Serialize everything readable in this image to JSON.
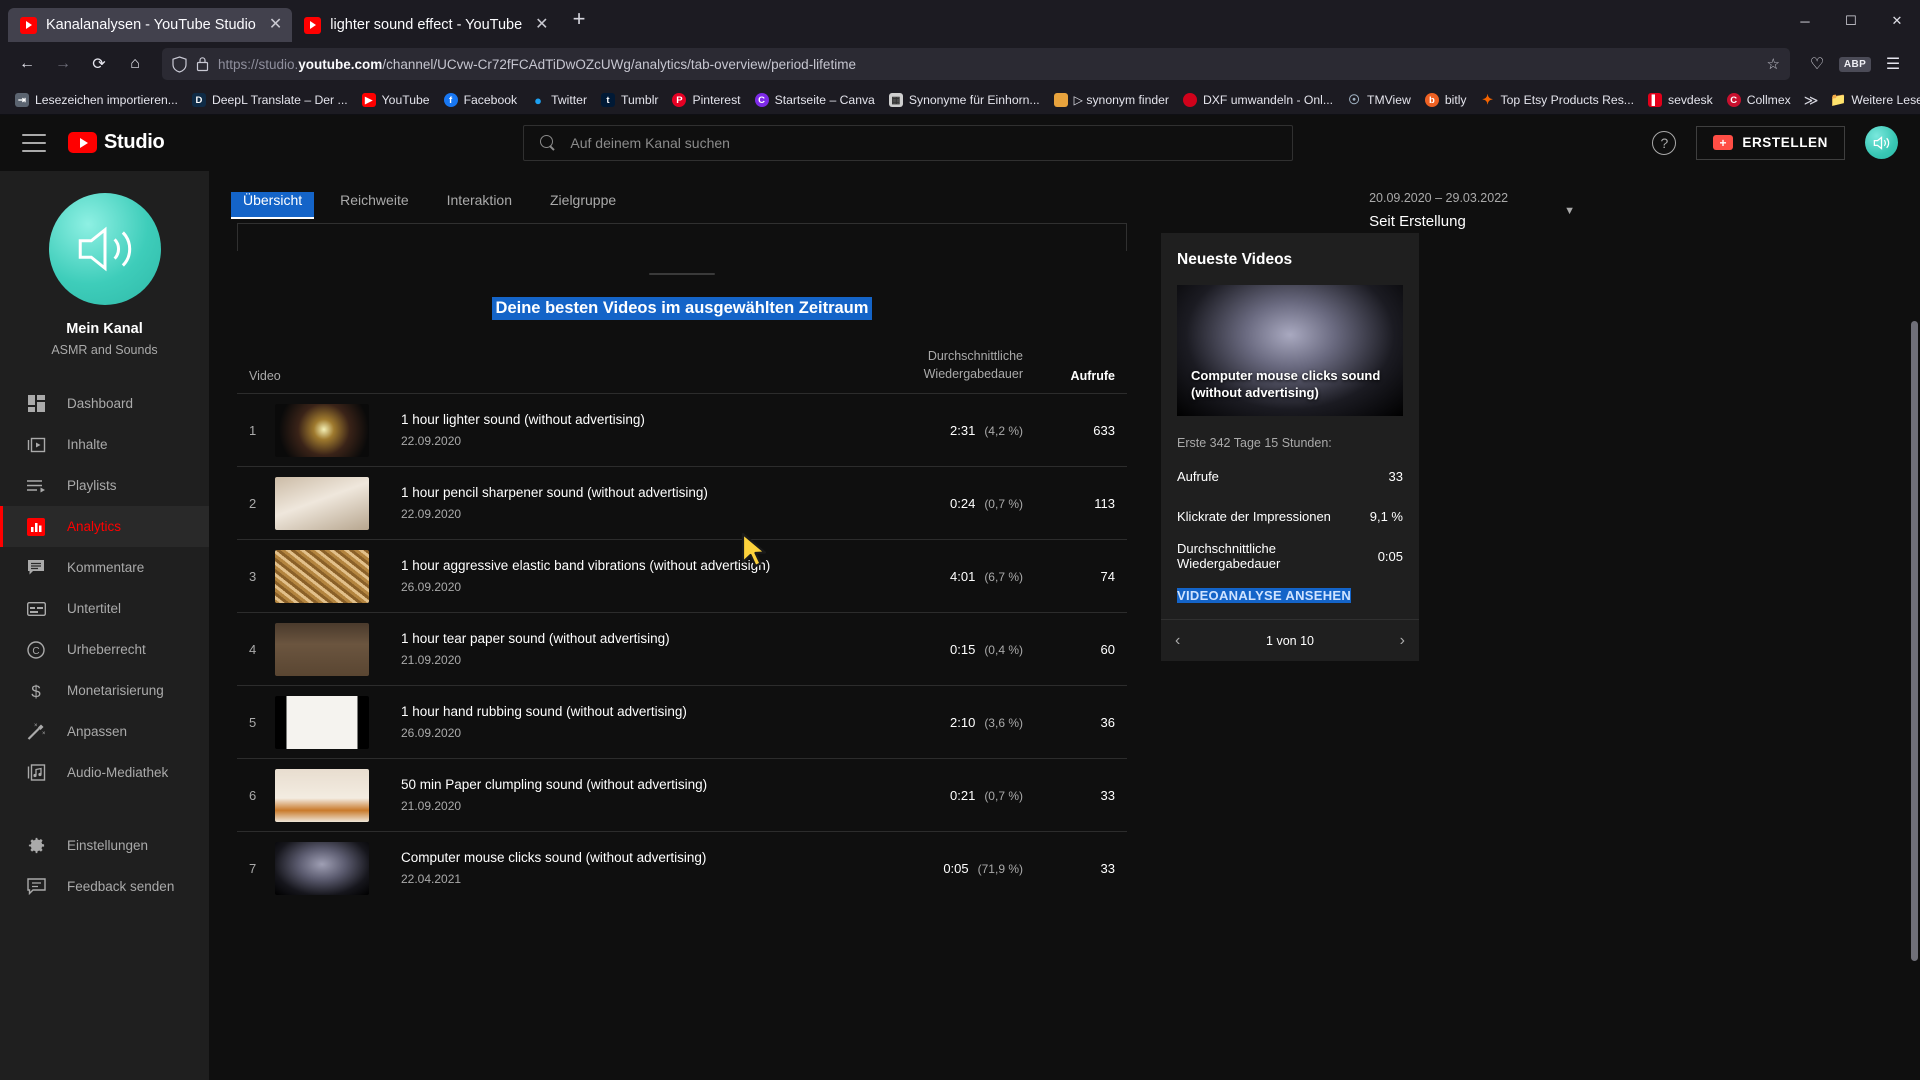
{
  "browser": {
    "tabs": [
      {
        "title": "Kanalanalysen - YouTube Studio",
        "close": "✕",
        "active": true
      },
      {
        "title": "lighter sound effect - YouTube",
        "close": "✕",
        "active": false
      }
    ],
    "new_tab_label": "+",
    "window_controls": {
      "minimize": "─",
      "maximize": "☐",
      "close": "✕"
    },
    "nav": {
      "back": "←",
      "forward": "→",
      "reload": "⟳",
      "home": "⌂"
    },
    "url": {
      "prefix": "https://studio.",
      "domain": "youtube.com",
      "path": "/channel/UCvw-Cr72fFCAdTiDwOZcUWg/analytics/tab-overview/period-lifetime",
      "shield_icon": "tracking-protection-shield",
      "lock_icon": "padlock",
      "bookmark_star": "☆"
    },
    "toolbar_right": {
      "pocket": "♡",
      "account_badge": "ABP",
      "menu": "☰"
    },
    "bookmarks": [
      {
        "label": "Lesezeichen importieren...",
        "color": "#5b6470",
        "glyph": "⇥"
      },
      {
        "label": "DeepL Translate – Der ...",
        "color": "#0f2b46",
        "glyph": "D"
      },
      {
        "label": "YouTube",
        "color": "#ff0000",
        "glyph": "▶"
      },
      {
        "label": "Facebook",
        "color": "#1877f2",
        "glyph": "f"
      },
      {
        "label": "Twitter",
        "color": "#1da1f2",
        "glyph": "t"
      },
      {
        "label": "Tumblr",
        "color": "#001935",
        "glyph": "t"
      },
      {
        "label": "Pinterest",
        "color": "#e60023",
        "glyph": "P"
      },
      {
        "label": "Startseite – Canva",
        "color": "#7d2ae8",
        "glyph": "C"
      },
      {
        "label": "Synonyme für Einhorn...",
        "color": "#cfcfcf",
        "glyph": "▦"
      },
      {
        "label": "▷ synonym finder",
        "color": "#e8a33d",
        "glyph": "▮"
      },
      {
        "label": "DXF umwandeln - Onl...",
        "color": "#d0021b",
        "glyph": "●"
      },
      {
        "label": "TMView",
        "color": "#5d6d7e",
        "glyph": "⊕"
      },
      {
        "label": "bitly",
        "color": "#ee6123",
        "glyph": "b"
      },
      {
        "label": "Top Etsy Products Res...",
        "color": "#f56400",
        "glyph": "✦"
      },
      {
        "label": "sevdesk",
        "color": "#e2001a",
        "glyph": "█"
      },
      {
        "label": "Collmex",
        "color": "#c8102e",
        "glyph": "C"
      }
    ],
    "overflow_chevron": "≫",
    "other_bookmarks": {
      "label": "Weitere Lesezeichen",
      "icon": "folder-icon"
    }
  },
  "studio": {
    "header": {
      "menu_icon": "hamburger-menu",
      "logo_text": "Studio",
      "search_placeholder": "Auf deinem Kanal suchen",
      "help_label": "?",
      "create_label": "ERSTELLEN",
      "create_icon": "video-camera-plus-icon",
      "avatar_icon": "channel-avatar-speaker"
    },
    "sidebar": {
      "channel_name": "Mein Kanal",
      "channel_subtitle": "ASMR and Sounds",
      "avatar_icon": "speaker-sound-icon",
      "items": [
        {
          "label": "Dashboard",
          "icon": "dashboard-icon",
          "active": false
        },
        {
          "label": "Inhalte",
          "icon": "content-video-icon",
          "active": false
        },
        {
          "label": "Playlists",
          "icon": "playlist-icon",
          "active": false
        },
        {
          "label": "Analytics",
          "icon": "analytics-bars-icon",
          "active": true
        },
        {
          "label": "Kommentare",
          "icon": "comments-icon",
          "active": false
        },
        {
          "label": "Untertitel",
          "icon": "subtitles-icon",
          "active": false
        },
        {
          "label": "Urheberrecht",
          "icon": "copyright-icon",
          "active": false
        },
        {
          "label": "Monetarisierung",
          "icon": "dollar-icon",
          "active": false
        },
        {
          "label": "Anpassen",
          "icon": "magic-wand-icon",
          "active": false
        },
        {
          "label": "Audio-Mediathek",
          "icon": "audio-library-icon",
          "active": false
        }
      ],
      "bottom_items": [
        {
          "label": "Einstellungen",
          "icon": "gear-icon"
        },
        {
          "label": "Feedback senden",
          "icon": "feedback-icon"
        }
      ]
    },
    "tabs": [
      {
        "label": "Übersicht",
        "active": true
      },
      {
        "label": "Reichweite",
        "active": false
      },
      {
        "label": "Interaktion",
        "active": false
      },
      {
        "label": "Zielgruppe",
        "active": false
      }
    ],
    "date_range": {
      "period": "20.09.2020 – 29.03.2022",
      "label": "Seit Erstellung",
      "caret": "▼"
    },
    "top_videos": {
      "title": "Deine besten Videos im ausgewählten Zeitraum",
      "columns": {
        "video": "Video",
        "avg_duration_line1": "Durchschnittliche",
        "avg_duration_line2": "Wiedergabedauer",
        "views": "Aufrufe"
      },
      "rows": [
        {
          "rank": "1",
          "title": "1 hour lighter sound (without advertising)",
          "date": "22.09.2020",
          "duration": "2:31",
          "percent": "(4,2 %)",
          "views": "633",
          "thumb": "lighter-flame"
        },
        {
          "rank": "2",
          "title": "1 hour pencil sharpener sound (without advertising)",
          "date": "22.09.2020",
          "duration": "0:24",
          "percent": "(0,7 %)",
          "views": "113",
          "thumb": "pencil-sharpener"
        },
        {
          "rank": "3",
          "title": "1 hour aggressive elastic band vibrations (without advertisign)",
          "date": "26.09.2020",
          "duration": "4:01",
          "percent": "(6,7 %)",
          "views": "74",
          "thumb": "rubber-bands"
        },
        {
          "rank": "4",
          "title": "1 hour tear paper sound (without advertising)",
          "date": "21.09.2020",
          "duration": "0:15",
          "percent": "(0,4 %)",
          "views": "60",
          "thumb": "torn-paper"
        },
        {
          "rank": "5",
          "title": "1 hour hand rubbing sound (without advertising)",
          "date": "26.09.2020",
          "duration": "2:10",
          "percent": "(3,6 %)",
          "views": "36",
          "thumb": "hands"
        },
        {
          "rank": "6",
          "title": "50 min Paper clumpling sound (without advertising)",
          "date": "21.09.2020",
          "duration": "0:21",
          "percent": "(0,7 %)",
          "views": "33",
          "thumb": "crumpled-paper"
        },
        {
          "rank": "7",
          "title": "Computer mouse clicks sound (without advertising)",
          "date": "22.04.2021",
          "duration": "0:05",
          "percent": "(71,9 %)",
          "views": "33",
          "thumb": "computer-mouse"
        }
      ]
    },
    "latest_videos": {
      "title": "Neueste Videos",
      "video_title": "Computer mouse clicks sound (without advertising)",
      "thumb": "computer-mouse",
      "period_note": "Erste 342 Tage 15 Stunden:",
      "metrics": [
        {
          "label": "Aufrufe",
          "value": "33"
        },
        {
          "label": "Klickrate der Impressionen",
          "value": "9,1 %"
        },
        {
          "label": "Durchschnittliche Wiedergabedauer",
          "value": "0:05"
        }
      ],
      "cta": "VIDEOANALYSE ANSEHEN",
      "pager": {
        "prev": "‹",
        "label": "1 von 10",
        "next": "›"
      }
    }
  },
  "colors": {
    "brand_red": "#ff0000",
    "link_blue": "#3ea6ff",
    "selection_blue": "#1464c8",
    "app_bg": "#0f0f0f",
    "panel_bg": "#1f1f1f",
    "chrome_bg": "#1c1b22"
  }
}
